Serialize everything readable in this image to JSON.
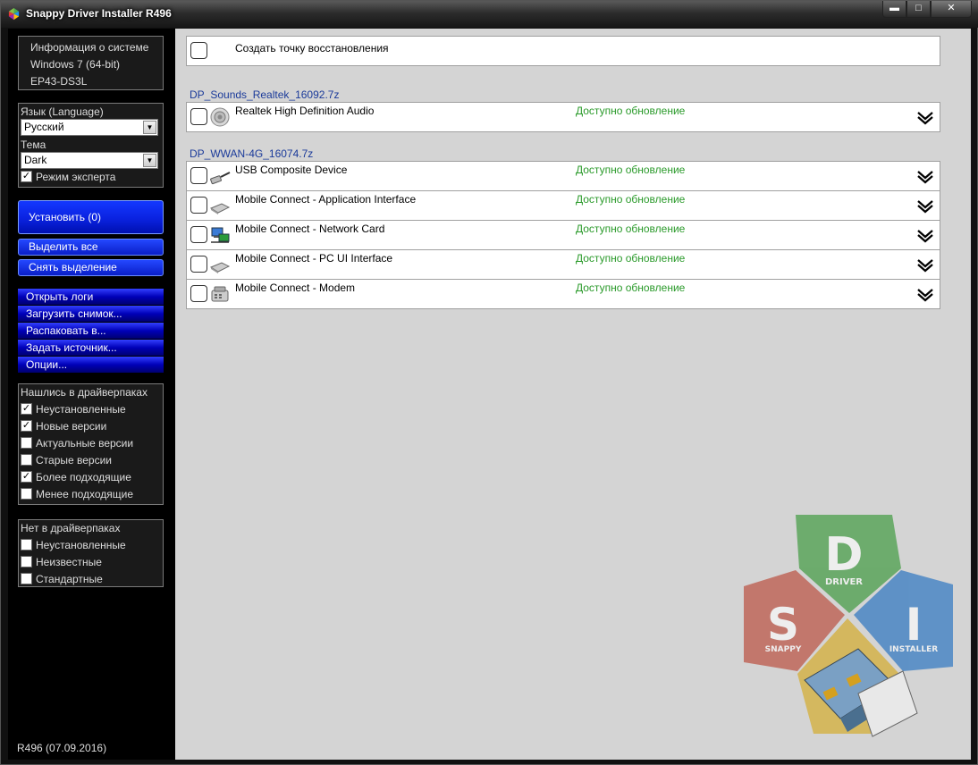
{
  "window": {
    "title": "Snappy Driver Installer R496"
  },
  "sidebar": {
    "sysinfo": {
      "line1": "Информация о системе",
      "line2": "Windows 7 (64-bit)",
      "line3": "EP43-DS3L"
    },
    "language_label": "Язык (Language)",
    "language_value": "Русский",
    "theme_label": "Тема",
    "theme_value": "Dark",
    "expert_mode": {
      "label": "Режим эксперта",
      "checked": true
    },
    "install_button": "Установить (0)",
    "select_all": "Выделить все",
    "deselect": "Снять выделение",
    "menu": [
      "Открыть логи",
      "Загрузить снимок...",
      "Распаковать в...",
      "Задать источник...",
      "Опции..."
    ],
    "found_group": {
      "header": "Нашлись в драйверпаках",
      "items": [
        {
          "label": "Неустановленные",
          "checked": true
        },
        {
          "label": "Новые версии",
          "checked": true
        },
        {
          "label": "Актуальные версии",
          "checked": false
        },
        {
          "label": "Старые версии",
          "checked": false
        },
        {
          "label": "Более подходящие",
          "checked": true
        },
        {
          "label": "Менее подходящие",
          "checked": false
        }
      ]
    },
    "notfound_group": {
      "header": "Нет в драйверпаках",
      "items": [
        {
          "label": "Неустановленные",
          "checked": false
        },
        {
          "label": "Неизвестные",
          "checked": false
        },
        {
          "label": "Стандартные",
          "checked": false
        }
      ]
    },
    "version": "R496 (07.09.2016)"
  },
  "main": {
    "restore_point": "Создать точку восстановления",
    "packs": [
      {
        "name": "DP_Sounds_Realtek_16092.7z",
        "devices": [
          {
            "name": "Realtek High Definition Audio",
            "status": "Доступно обновление",
            "icon": "speaker-icon"
          }
        ]
      },
      {
        "name": "DP_WWAN-4G_16074.7z",
        "devices": [
          {
            "name": "USB Composite Device",
            "status": "Доступно обновление",
            "icon": "usb-plug-icon"
          },
          {
            "name": "Mobile Connect - Application Interface",
            "status": "Доступно обновление",
            "icon": "modem-icon"
          },
          {
            "name": "Mobile Connect - Network Card",
            "status": "Доступно обновление",
            "icon": "network-icon"
          },
          {
            "name": "Mobile Connect - PC UI Interface",
            "status": "Доступно обновление",
            "icon": "modem-icon"
          },
          {
            "name": "Mobile Connect - Modem",
            "status": "Доступно обновление",
            "icon": "phone-modem-icon"
          }
        ]
      }
    ]
  },
  "logo_letters": {
    "d": "D",
    "d_word": "DRIVER",
    "s": "S",
    "s_word": "SNAPPY",
    "i": "I",
    "i_word": "INSTALLER"
  }
}
